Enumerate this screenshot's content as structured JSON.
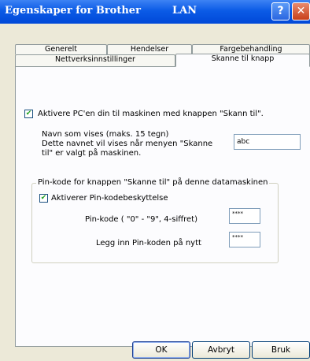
{
  "window": {
    "title_part1": "Egenskaper for Brother",
    "title_part2": "LAN",
    "help_glyph": "?",
    "close_glyph": "✕"
  },
  "tabs": {
    "row1": [
      "Generelt",
      "Hendelser",
      "Fargebehandling"
    ],
    "row2": [
      "Nettverksinnstillinger",
      "Skanne til knapp"
    ],
    "active": "Skanne til knapp"
  },
  "main": {
    "enable_checkbox_label": "Aktivere PC'en din til maskinen med knappen \"Skann til\".",
    "enable_checked": true,
    "name_label_line1": "Navn som vises (maks. 15 tegn)",
    "name_label_line2": "Dette navnet vil vises når menyen \"Skanne",
    "name_label_line3": "til\" er valgt på maskinen.",
    "name_value": "abc"
  },
  "pin_group": {
    "legend": "Pin-kode for knappen \"Skanne til\" på denne datamaskinen",
    "protect_label": "Aktiverer Pin-kodebeskyttelse",
    "protect_checked": true,
    "pin_label": "Pin-kode ( \"0\" - \"9\", 4-siffret)",
    "pin_value": "****",
    "pin_again_label": "Legg inn Pin-koden på nytt",
    "pin_again_value": "****"
  },
  "buttons": {
    "ok": "OK",
    "cancel": "Avbryt",
    "apply": "Bruk"
  },
  "icons": {
    "check": "✔"
  }
}
